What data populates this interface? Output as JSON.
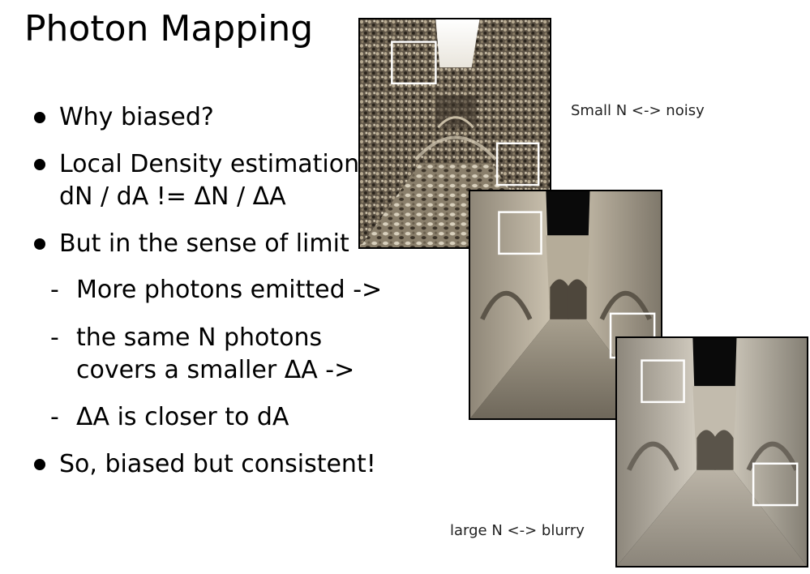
{
  "slide": {
    "title": "Photon Mapping",
    "bullets": [
      {
        "lines": [
          "Why biased?"
        ]
      },
      {
        "lines": [
          "Local Density estimation",
          "dN / dA != ΔN / ΔA"
        ]
      },
      {
        "lines": [
          "But in the sense of limit"
        ]
      },
      {
        "lines": [
          "So, biased but consistent!"
        ]
      }
    ],
    "subbullets": [
      {
        "marker": "-",
        "lines": [
          "More photons emitted ->"
        ]
      },
      {
        "marker": "-",
        "lines": [
          "the same N photons",
          "covers a smaller ΔA ->"
        ]
      },
      {
        "marker": "-",
        "lines": [
          "ΔA is closer to dA"
        ]
      }
    ]
  },
  "captions": {
    "noisy": "Small N <-> noisy",
    "blurry": "large N <-> blurry"
  }
}
